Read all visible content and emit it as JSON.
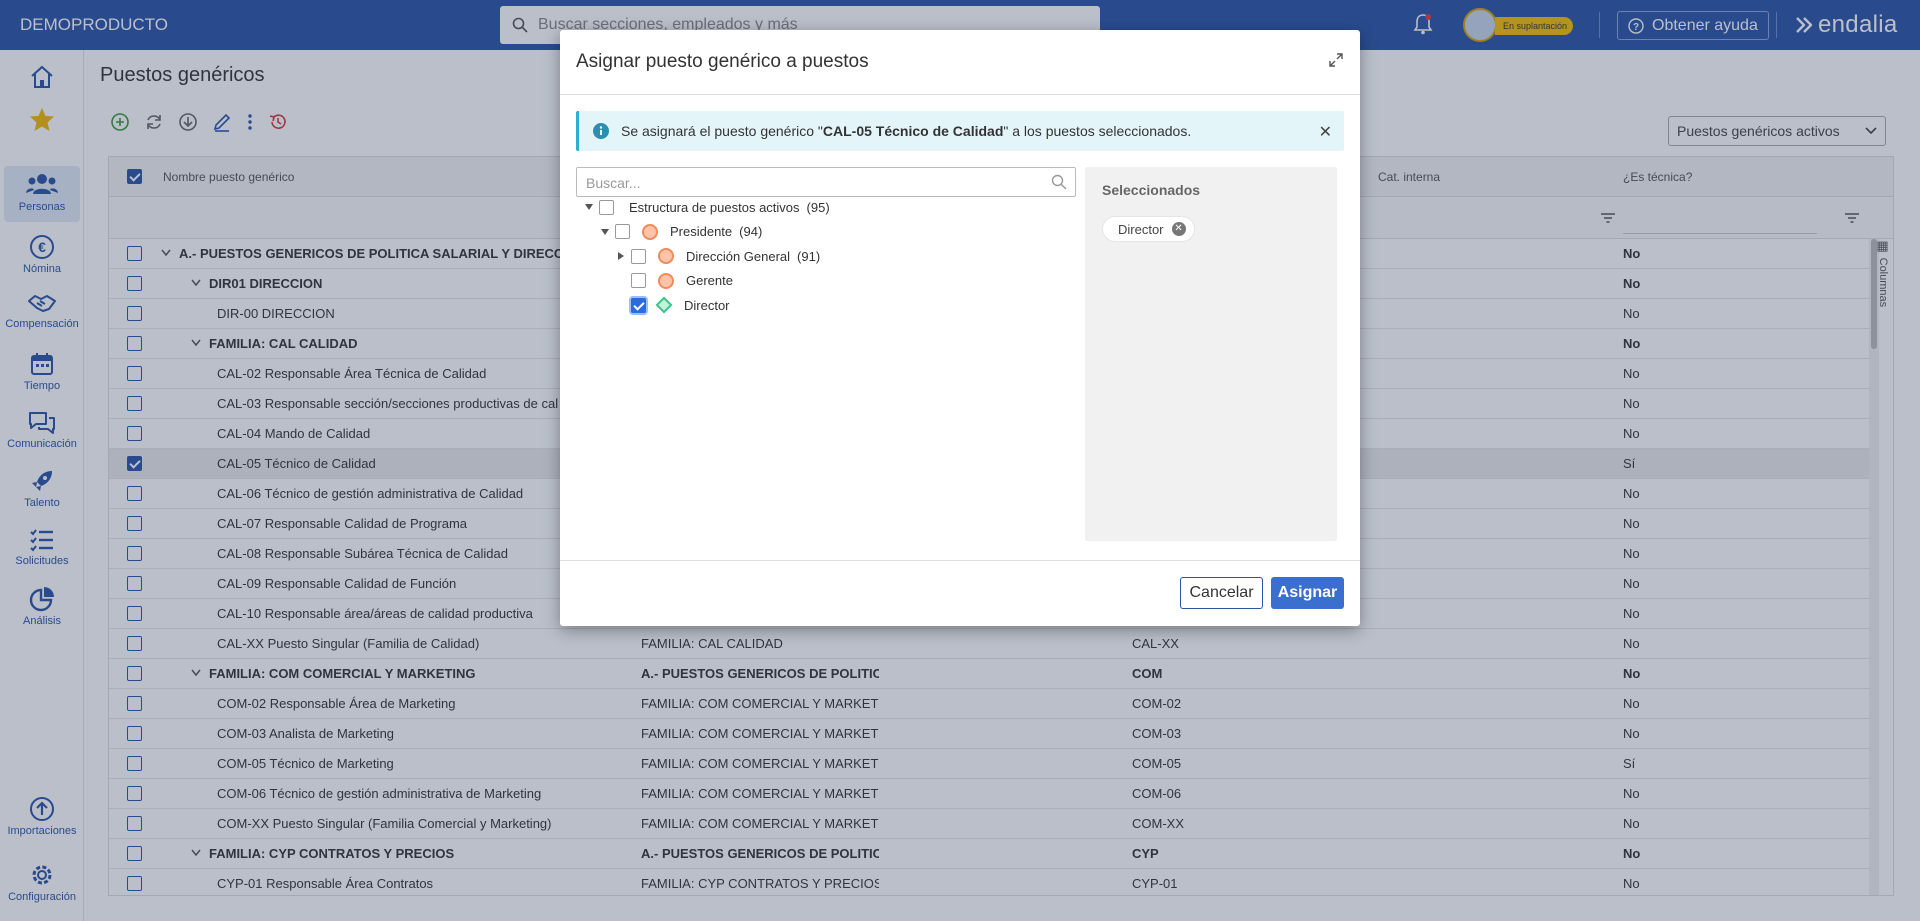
{
  "app": {
    "brand": "DEMOPRODUCTO",
    "search_placeholder": "Buscar secciones, empleados y más",
    "impersonation_badge": "En suplantación",
    "help_label": "Obtener ayuda",
    "logo_text": "endalia",
    "accent": "#2a54a6"
  },
  "sidebar": {
    "items": [
      {
        "label": "",
        "icon": "home-icon"
      },
      {
        "label": "",
        "icon": "star-icon"
      },
      {
        "label": "Personas",
        "icon": "people-icon"
      },
      {
        "label": "Nómina",
        "icon": "euro-icon"
      },
      {
        "label": "Compensación",
        "icon": "handshake-icon"
      },
      {
        "label": "Tiempo",
        "icon": "calendar-icon"
      },
      {
        "label": "Comunicación",
        "icon": "chat-icon"
      },
      {
        "label": "Talento",
        "icon": "rocket-icon"
      },
      {
        "label": "Solicitudes",
        "icon": "checklist-icon"
      },
      {
        "label": "Análisis",
        "icon": "pie-chart-icon"
      },
      {
        "label": "Importaciones",
        "icon": "upload-icon"
      },
      {
        "label": "Configuración",
        "icon": "gear-icon"
      }
    ]
  },
  "page": {
    "title": "Puestos genéricos",
    "filter_select": "Puestos genéricos activos",
    "columns_label": "Columnas",
    "headers": {
      "name": "Nombre puesto genérico",
      "internal": "Cat. interna",
      "technical": "¿Es técnica?"
    },
    "rows": [
      {
        "name": "A.- PUESTOS GENERICOS DE POLITICA SALARIAL Y DIRECCIÓN",
        "parent": "",
        "code": "",
        "tech": "No",
        "level": 0,
        "group": true,
        "checked": false
      },
      {
        "name": "DIR01 DIRECCION",
        "parent": "",
        "code": "",
        "tech": "No",
        "level": 1,
        "group": true,
        "checked": false
      },
      {
        "name": "DIR-00 DIRECCION",
        "parent": "",
        "code": "",
        "tech": "No",
        "level": 2,
        "group": false,
        "checked": false
      },
      {
        "name": "FAMILIA: CAL CALIDAD",
        "parent": "",
        "code": "",
        "tech": "No",
        "level": 1,
        "group": true,
        "checked": false
      },
      {
        "name": "CAL-02 Responsable Área Técnica de Calidad",
        "parent": "",
        "code": "",
        "tech": "No",
        "level": 2,
        "group": false,
        "checked": false
      },
      {
        "name": "CAL-03 Responsable sección/secciones productivas de cal",
        "parent": "",
        "code": "",
        "tech": "No",
        "level": 2,
        "group": false,
        "checked": false
      },
      {
        "name": "CAL-04 Mando de Calidad",
        "parent": "",
        "code": "",
        "tech": "No",
        "level": 2,
        "group": false,
        "checked": false
      },
      {
        "name": "CAL-05 Técnico de Calidad",
        "parent": "",
        "code": "",
        "tech": "Sí",
        "level": 2,
        "group": false,
        "checked": true
      },
      {
        "name": "CAL-06 Técnico de gestión administrativa de Calidad",
        "parent": "",
        "code": "",
        "tech": "No",
        "level": 2,
        "group": false,
        "checked": false
      },
      {
        "name": "CAL-07 Responsable Calidad de Programa",
        "parent": "",
        "code": "",
        "tech": "No",
        "level": 2,
        "group": false,
        "checked": false
      },
      {
        "name": "CAL-08 Responsable Subárea Técnica de Calidad",
        "parent": "",
        "code": "",
        "tech": "No",
        "level": 2,
        "group": false,
        "checked": false
      },
      {
        "name": "CAL-09 Responsable Calidad de Función",
        "parent": "",
        "code": "",
        "tech": "No",
        "level": 2,
        "group": false,
        "checked": false
      },
      {
        "name": "CAL-10 Responsable área/áreas de calidad productiva",
        "parent": "",
        "code": "",
        "tech": "No",
        "level": 2,
        "group": false,
        "checked": false
      },
      {
        "name": "CAL-XX Puesto Singular (Familia de Calidad)",
        "parent": "FAMILIA: CAL CALIDAD",
        "code": "CAL-XX",
        "tech": "No",
        "level": 2,
        "group": false,
        "checked": false
      },
      {
        "name": "FAMILIA: COM COMERCIAL Y MARKETING",
        "parent": "A.- PUESTOS GENERICOS DE POLITICA S",
        "code": "COM",
        "tech": "No",
        "level": 1,
        "group": true,
        "checked": false
      },
      {
        "name": "COM-02 Responsable Área de Marketing",
        "parent": "FAMILIA: COM COMERCIAL Y MARKETIN",
        "code": "COM-02",
        "tech": "No",
        "level": 2,
        "group": false,
        "checked": false
      },
      {
        "name": "COM-03 Analista de Marketing",
        "parent": "FAMILIA: COM COMERCIAL Y MARKETIN",
        "code": "COM-03",
        "tech": "No",
        "level": 2,
        "group": false,
        "checked": false
      },
      {
        "name": "COM-05 Técnico de Marketing",
        "parent": "FAMILIA: COM COMERCIAL Y MARKETIN",
        "code": "COM-05",
        "tech": "Sí",
        "level": 2,
        "group": false,
        "checked": false
      },
      {
        "name": "COM-06 Técnico de gestión administrativa de Marketing",
        "parent": "FAMILIA: COM COMERCIAL Y MARKETIN",
        "code": "COM-06",
        "tech": "No",
        "level": 2,
        "group": false,
        "checked": false
      },
      {
        "name": "COM-XX Puesto Singular (Familia Comercial y Marketing)",
        "parent": "FAMILIA: COM COMERCIAL Y MARKETIN",
        "code": "COM-XX",
        "tech": "No",
        "level": 2,
        "group": false,
        "checked": false
      },
      {
        "name": "FAMILIA: CYP CONTRATOS Y PRECIOS",
        "parent": "A.- PUESTOS GENERICOS DE POLITICA S",
        "code": "CYP",
        "tech": "No",
        "level": 1,
        "group": true,
        "checked": false
      },
      {
        "name": "CYP-01 Responsable Área Contratos",
        "parent": "FAMILIA: CYP CONTRATOS Y PRECIOS",
        "code": "CYP-01",
        "tech": "No",
        "level": 2,
        "group": false,
        "checked": false
      }
    ]
  },
  "modal": {
    "title": "Asignar puesto genérico a puestos",
    "info_prefix": "Se asignará el puesto genérico \"",
    "info_bold": "CAL-05 Técnico de Calidad",
    "info_suffix": "\" a los puestos seleccionados.",
    "search_placeholder": "Buscar...",
    "tree": [
      {
        "label": "Estructura de puestos activos",
        "count": "(95)",
        "depth": 0,
        "caret": "down",
        "node": "none",
        "checked": false
      },
      {
        "label": "Presidente",
        "count": "(94)",
        "depth": 1,
        "caret": "down",
        "node": "circle",
        "checked": false
      },
      {
        "label": "Dirección General",
        "count": "(91)",
        "depth": 2,
        "caret": "right",
        "node": "circle",
        "checked": false
      },
      {
        "label": "Gerente",
        "count": "",
        "depth": 2,
        "caret": "none",
        "node": "circle",
        "checked": false
      },
      {
        "label": "Director",
        "count": "",
        "depth": 2,
        "caret": "none",
        "node": "diamond",
        "checked": true
      }
    ],
    "selected_title": "Seleccionados",
    "selected": [
      "Director"
    ],
    "cancel_label": "Cancelar",
    "assign_label": "Asignar"
  }
}
